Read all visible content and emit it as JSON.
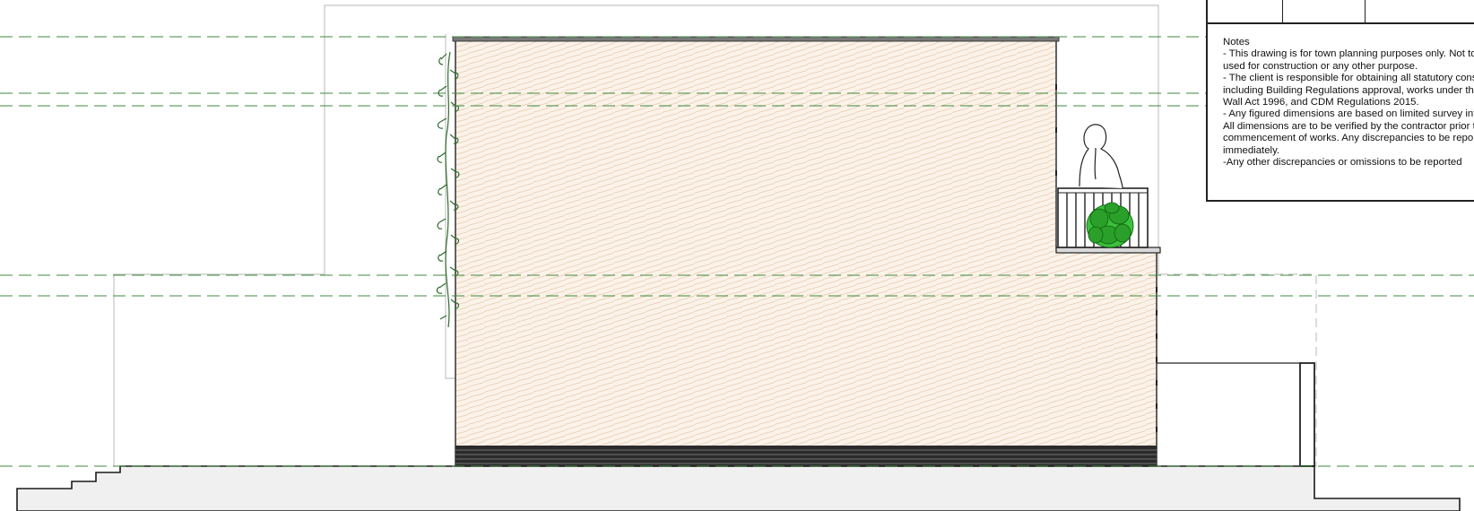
{
  "notes": {
    "title": "Notes",
    "lines": [
      "- This drawing is for town planning purposes only. Not to be",
      "used for construction or any other purpose.",
      "- The client is responsible for obtaining all statutory consents,",
      "including Building Regulations approval, works under the Party",
      "Wall Act 1996, and CDM Regulations 2015.",
      "- Any figured dimensions are based on limited survey information.",
      "All dimensions are to be verified by the contractor prior to the",
      "commencement of works. Any discrepancies to be reported",
      "immediately.",
      "-Any other discrepancies or omissions to be reported"
    ]
  },
  "colors": {
    "brick_hatch": "#e8c9a8",
    "brick_fill": "#fbf3ea",
    "level_line": "#3f8a3f",
    "outline": "#222222",
    "ghost": "#b8b8b8",
    "ground": "#f0f0f0",
    "plinth": "#2b2b2b",
    "planting": "#2aa02a",
    "climber": "#2e6b2e"
  }
}
